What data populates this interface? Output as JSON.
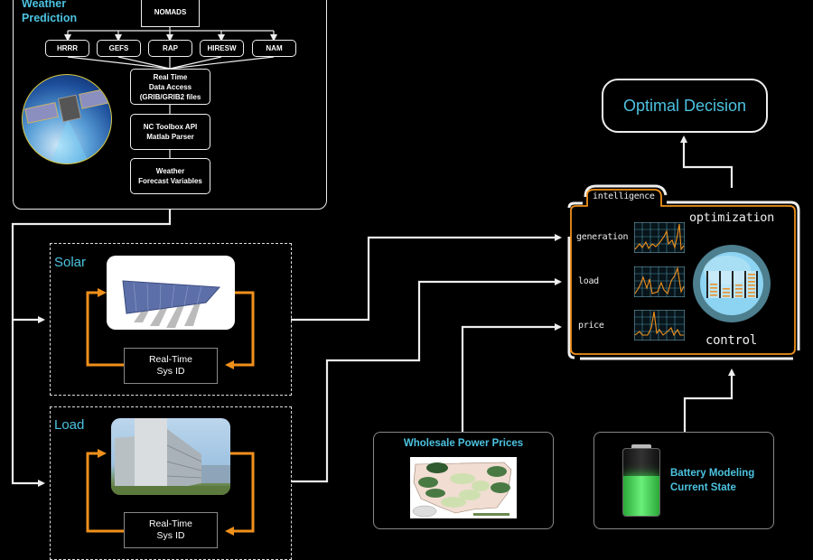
{
  "weather": {
    "title_line1": "Weather",
    "title_line2": "Prediction",
    "source": "NOMADS",
    "models": [
      "HRRR",
      "GEFS",
      "RAP",
      "HIRESW",
      "NAM"
    ],
    "pipeline": [
      {
        "line1": "Real Time",
        "line2": "Data Access",
        "line3": "(GRIB/GRIB2 files"
      },
      {
        "line1": "NC Toolbox API",
        "line2": "Matlab Parser"
      },
      {
        "line1": "Weather",
        "line2": "Forecast Variables"
      }
    ]
  },
  "solar": {
    "label": "Solar",
    "sysid_line1": "Real-Time",
    "sysid_line2": "Sys ID"
  },
  "load": {
    "label": "Load",
    "sysid_line1": "Real-Time",
    "sysid_line2": "Sys ID"
  },
  "intelligence": {
    "tab_label": "intelligence",
    "optimization_label": "optimization",
    "control_label": "control",
    "signals": [
      "generation",
      "load",
      "price"
    ]
  },
  "decision": {
    "label": "Optimal Decision"
  },
  "prices": {
    "title": "Wholesale Power Prices"
  },
  "battery": {
    "line1": "Battery Modeling",
    "line2": "Current State",
    "charge_fraction": 0.6
  },
  "colors": {
    "accent_cyan": "#4cc3e0",
    "accent_orange": "#f0901c",
    "line_white": "#eeeeee",
    "battery_green": "#3ddc4a"
  }
}
